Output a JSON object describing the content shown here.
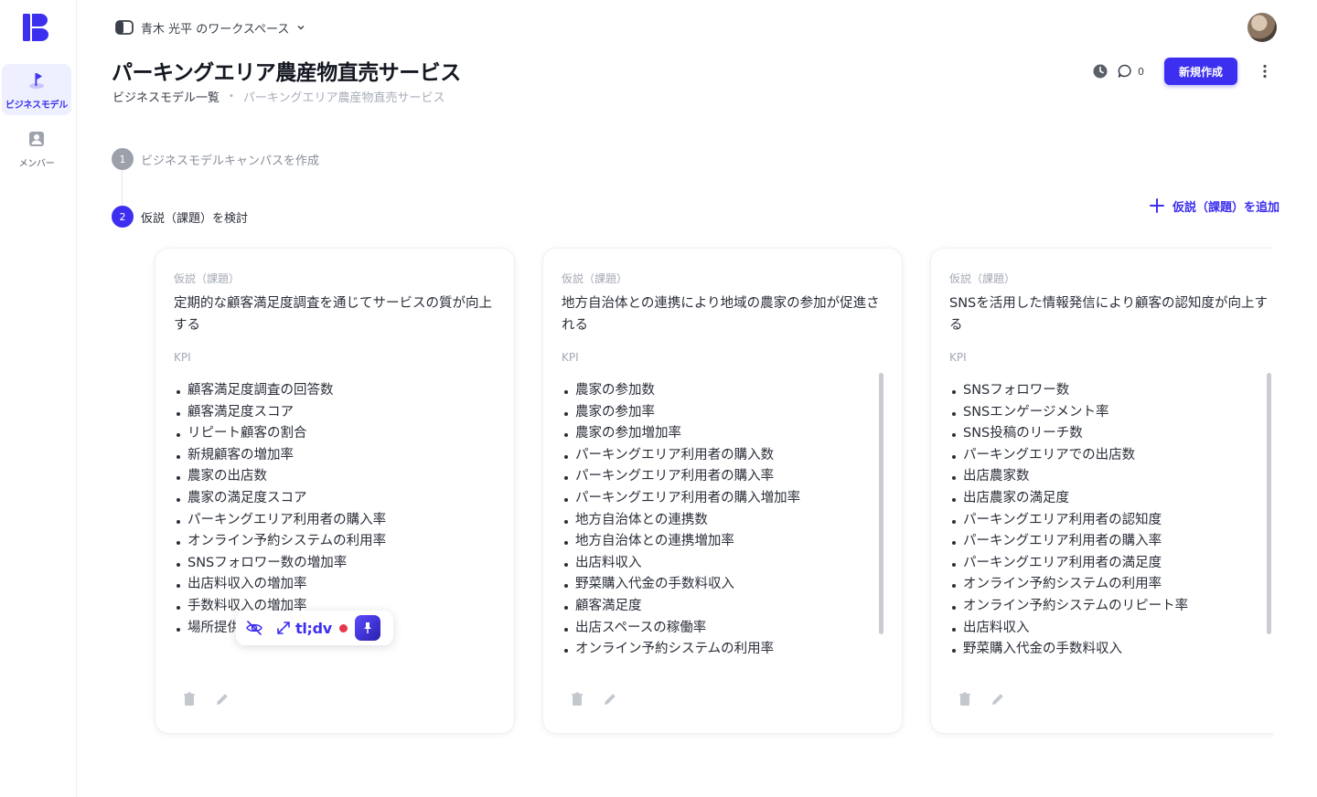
{
  "sidebar": {
    "logo_icon": "brand-logo-icon",
    "items": [
      {
        "label": "ビジネスモデル",
        "icon": "flag-icon",
        "active": true
      },
      {
        "label": "メンバー",
        "icon": "person-icon",
        "active": false
      }
    ]
  },
  "header": {
    "workspace": "青木 光平 のワークスペース",
    "title": "パーキングエリア農産物直売サービス",
    "breadcrumb": {
      "root": "ビジネスモデル一覧",
      "separator": "•",
      "current": "パーキングエリア農産物直売サービス"
    },
    "comment_count": "0",
    "new_button": "新規作成"
  },
  "steps": [
    {
      "number": "1",
      "label": "ビジネスモデルキャンパスを作成"
    },
    {
      "number": "2",
      "label": "仮説（課題）を検討"
    }
  ],
  "add_hypothesis": "仮説（課題）を追加",
  "cards": [
    {
      "label": "仮説（課題）",
      "title": "定期的な顧客満足度調査を通じてサービスの質が向上する",
      "kpi_label": "KPI",
      "kpis": [
        "顧客満足度調査の回答数",
        "顧客満足度スコア",
        "リピート顧客の割合",
        "新規顧客の増加率",
        "農家の出店数",
        "農家の満足度スコア",
        "パーキングエリア利用者の購入率",
        "オンライン予約システムの利用率",
        "SNSフォロワー数の増加率",
        "出店料収入の増加率",
        "手数料収入の増加率",
        "場所提供"
      ]
    },
    {
      "label": "仮説（課題）",
      "title": "地方自治体との連携により地域の農家の参加が促進される",
      "kpi_label": "KPI",
      "kpis": [
        "農家の参加数",
        "農家の参加率",
        "農家の参加増加率",
        "パーキングエリア利用者の購入数",
        "パーキングエリア利用者の購入率",
        "パーキングエリア利用者の購入増加率",
        "地方自治体との連携数",
        "地方自治体との連携増加率",
        "出店料収入",
        "野菜購入代金の手数料収入",
        "顧客満足度",
        "出店スペースの稼働率",
        "オンライン予約システムの利用率"
      ]
    },
    {
      "label": "仮説（課題）",
      "title": "SNSを活用した情報発信により顧客の認知度が向上する",
      "kpi_label": "KPI",
      "kpis": [
        "SNSフォロワー数",
        "SNSエンゲージメント率",
        "SNS投稿のリーチ数",
        "パーキングエリアでの出店数",
        "出店農家数",
        "出店農家の満足度",
        "パーキングエリア利用者の認知度",
        "パーキングエリア利用者の購入率",
        "パーキングエリア利用者の満足度",
        "オンライン予約システムの利用率",
        "オンライン予約システムのリピート率",
        "出店料収入",
        "野菜購入代金の手数料収入"
      ]
    }
  ],
  "tldv": {
    "brand": "tl;dv"
  },
  "colors": {
    "accent": "#3d2ff0",
    "record": "#e5394b"
  }
}
